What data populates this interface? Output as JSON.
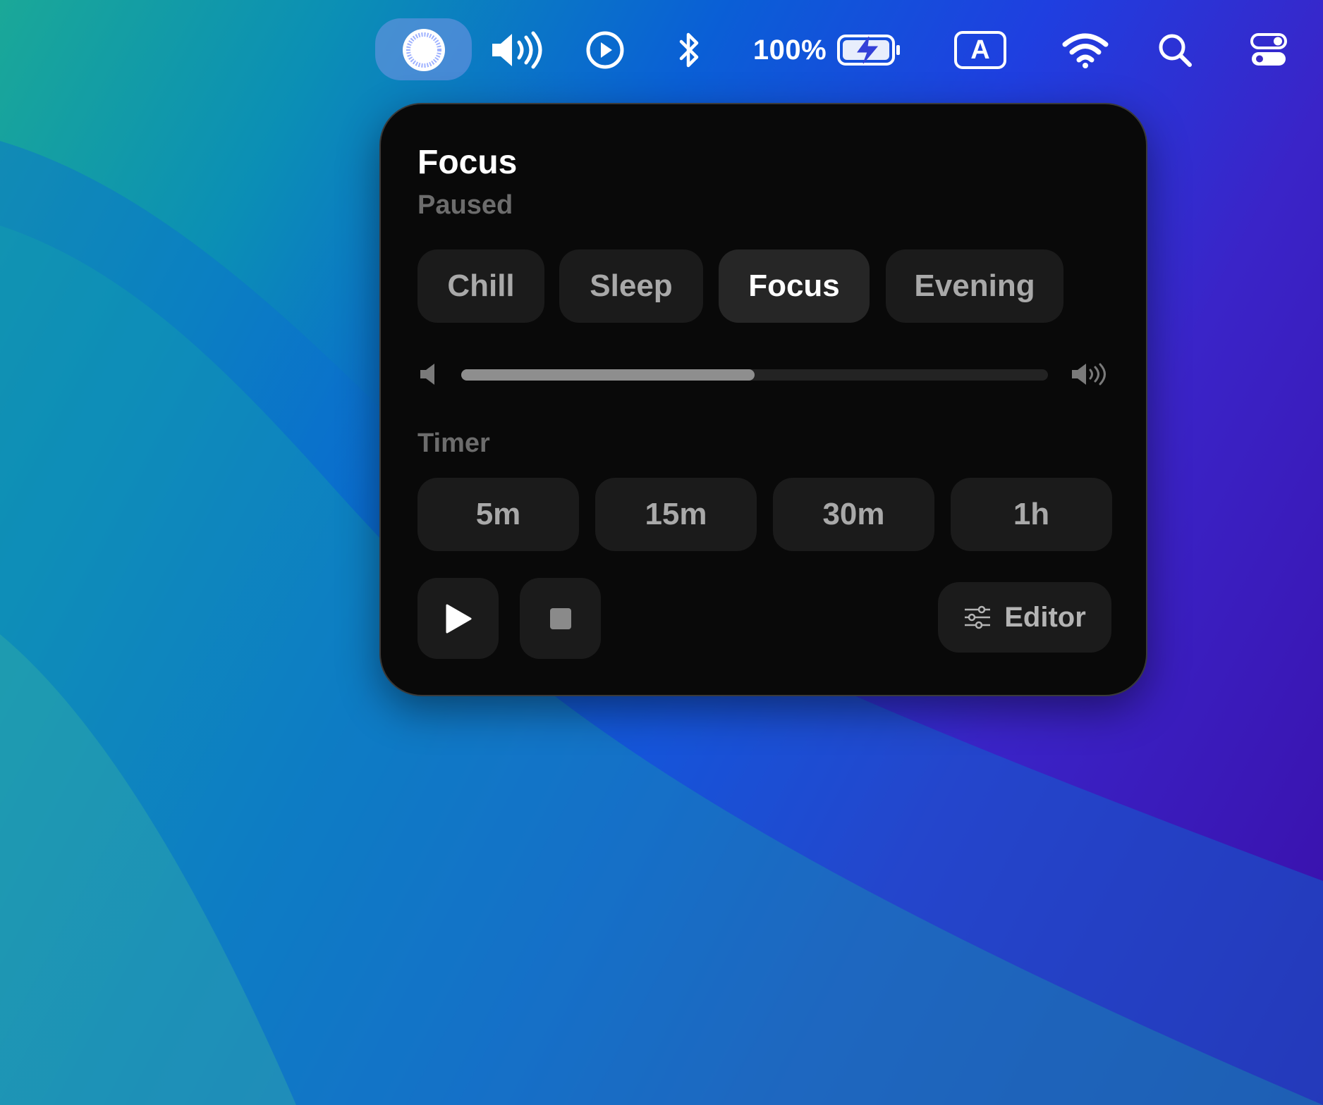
{
  "menubar": {
    "battery_percent": "100%",
    "input_source_letter": "A",
    "icons": [
      "noise-app-icon",
      "volume-icon",
      "play-circle-icon",
      "bluetooth-icon",
      "battery-charging-icon",
      "input-source-icon",
      "wifi-icon",
      "search-icon",
      "control-center-icon"
    ]
  },
  "panel": {
    "title": "Focus",
    "status": "Paused",
    "presets": [
      {
        "label": "Chill",
        "selected": false
      },
      {
        "label": "Sleep",
        "selected": false
      },
      {
        "label": "Focus",
        "selected": true
      },
      {
        "label": "Evening",
        "selected": false
      }
    ],
    "volume_level": 0.5,
    "timer_label": "Timer",
    "timers": [
      "5m",
      "15m",
      "30m",
      "1h"
    ],
    "editor_label": "Editor"
  },
  "colors": {
    "panel_bg": "#090909",
    "chip_bg": "#1b1b1b",
    "chip_selected_bg": "#262626",
    "muted_text": "#6c6c6c"
  }
}
